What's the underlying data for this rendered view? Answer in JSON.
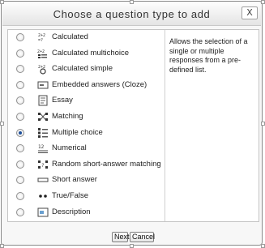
{
  "dialog": {
    "title": "Choose a question type to add",
    "close_label": "X"
  },
  "options": [
    {
      "label": "Calculated",
      "icon": "calculated-icon",
      "selected": false
    },
    {
      "label": "Calculated multichoice",
      "icon": "calculated-multichoice-icon",
      "selected": false
    },
    {
      "label": "Calculated simple",
      "icon": "calculated-simple-icon",
      "selected": false
    },
    {
      "label": "Embedded answers (Cloze)",
      "icon": "cloze-icon",
      "selected": false
    },
    {
      "label": "Essay",
      "icon": "essay-icon",
      "selected": false
    },
    {
      "label": "Matching",
      "icon": "matching-icon",
      "selected": false
    },
    {
      "label": "Multiple choice",
      "icon": "multichoice-icon",
      "selected": true
    },
    {
      "label": "Numerical",
      "icon": "numerical-icon",
      "selected": false
    },
    {
      "label": "Random short-answer matching",
      "icon": "random-matching-icon",
      "selected": false
    },
    {
      "label": "Short answer",
      "icon": "short-answer-icon",
      "selected": false
    },
    {
      "label": "True/False",
      "icon": "true-false-icon",
      "selected": false
    },
    {
      "label": "Description",
      "icon": "description-icon",
      "selected": false
    }
  ],
  "description": "Allows the selection of a single or multiple responses from a pre-defined list.",
  "buttons": {
    "next": "Next",
    "cancel": "Cancel"
  }
}
